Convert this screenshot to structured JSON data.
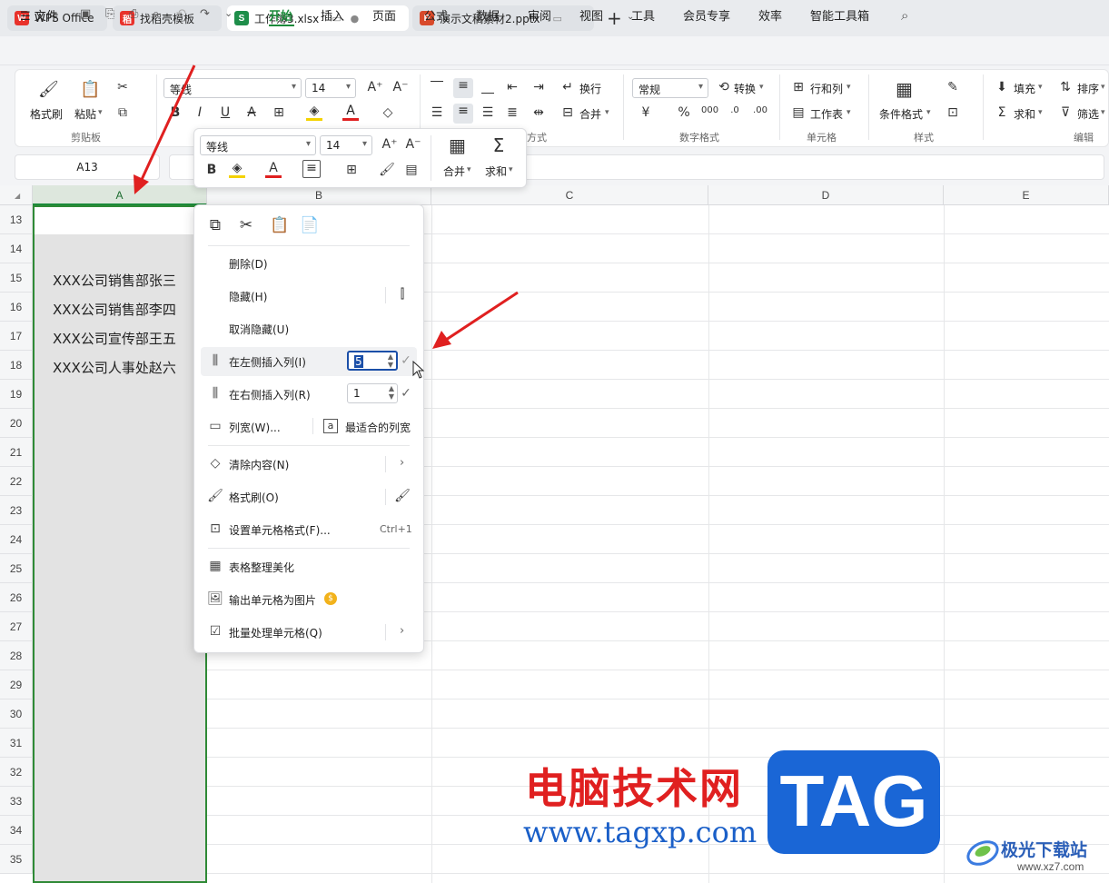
{
  "tabs": [
    {
      "label": "WPS Office",
      "logo": "W"
    },
    {
      "label": "找稻壳模板",
      "logo": "稻"
    },
    {
      "label": "工作簿3.xlsx",
      "logo": "S"
    },
    {
      "label": "演示文稿素材2.pptx",
      "logo": "P"
    }
  ],
  "menubar": {
    "file": "文件",
    "items": [
      "开始",
      "插入",
      "页面",
      "公式",
      "数据",
      "审阅",
      "视图",
      "工具",
      "会员专享",
      "效率",
      "智能工具箱"
    ],
    "active": "开始"
  },
  "ribbon": {
    "format_painter": "格式刷",
    "paste": "粘贴",
    "clipboard_group": "剪贴板",
    "font_name": "等线",
    "font_size": "14",
    "wrap": "换行",
    "merge": "合并",
    "align_group_tail": "方式",
    "number_format": "常规",
    "convert": "转换",
    "number_group": "数字格式",
    "row_col": "行和列",
    "worksheet": "工作表",
    "cell_group": "单元格",
    "cond_format": "条件格式",
    "style_group": "样式",
    "fill": "填充",
    "sort": "排序",
    "sum": "求和",
    "filter": "筛选",
    "edit_group": "编辑"
  },
  "namebox": "A13",
  "columns": [
    "A",
    "B",
    "C",
    "D",
    "E"
  ],
  "rows": [
    "13",
    "14",
    "15",
    "16",
    "17",
    "18",
    "19",
    "20",
    "21",
    "22",
    "23",
    "24",
    "25",
    "26",
    "27",
    "28",
    "29",
    "30",
    "31",
    "32",
    "33",
    "34",
    "35"
  ],
  "cells": {
    "A15": "XXX公司销售部张三",
    "A16": "XXX公司销售部李四",
    "A17": "XXX公司宣传部王五",
    "A18": "XXX公司人事处赵六"
  },
  "minibar": {
    "font_name": "等线",
    "font_size": "14",
    "merge": "合并",
    "sum": "求和"
  },
  "context_menu": {
    "delete": "删除(D)",
    "hide": "隐藏(H)",
    "unhide": "取消隐藏(U)",
    "insert_left": "在左侧插入列(I)",
    "insert_left_value": "5",
    "insert_right": "在右侧插入列(R)",
    "insert_right_value": "1",
    "col_width": "列宽(W)...",
    "best_fit": "最适合的列宽",
    "clear": "清除内容(N)",
    "format_painter": "格式刷(O)",
    "cell_format": "设置单元格格式(F)...",
    "cell_format_shortcut": "Ctrl+1",
    "beautify": "表格整理美化",
    "export_image": "输出单元格为图片",
    "batch": "批量处理单元格(Q)"
  },
  "watermark": {
    "title": "电脑技术网",
    "url": "www.tagxp.com",
    "tag": "TAG",
    "site2": "极光下载站",
    "site2_url": "www.xz7.com"
  },
  "colors": {
    "accent": "#1b8a3a",
    "arrow": "#e02020",
    "tag_blue": "#1a66d6"
  }
}
